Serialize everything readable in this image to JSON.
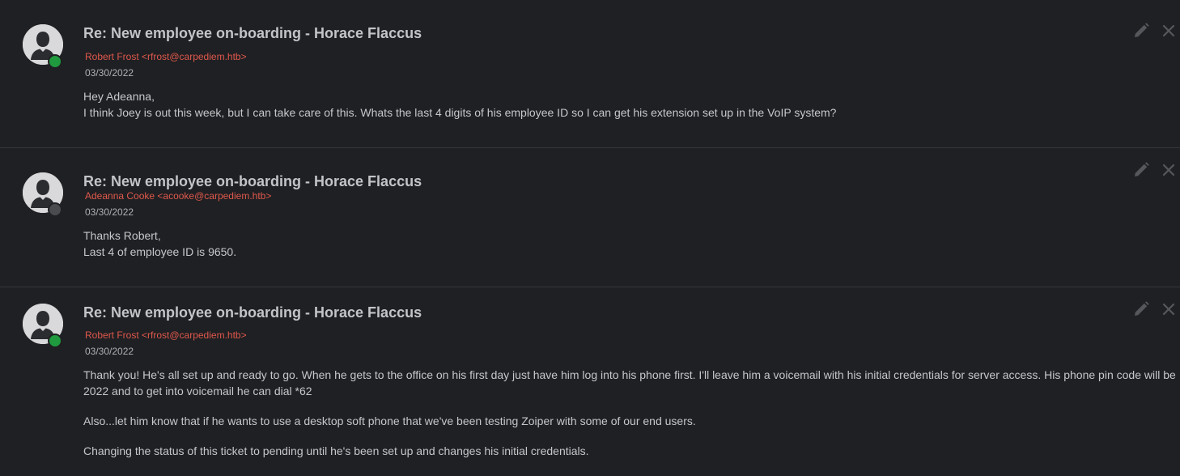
{
  "messages": [
    {
      "subject": "Re: New employee on-boarding - Horace Flaccus",
      "sender": "Robert Frost <rfrost@carpediem.htb>",
      "date": "03/30/2022",
      "status": "online",
      "body": [
        "Hey Adeanna,",
        "I think Joey is out this week, but I can take care of this. Whats the last 4 digits of his employee ID so I can get his extension set up in the VoIP system?"
      ]
    },
    {
      "subject": "Re: New employee on-boarding - Horace Flaccus",
      "sender": "Adeanna Cooke <acooke@carpediem.htb>",
      "date": "03/30/2022",
      "status": "offline",
      "body": [
        "Thanks Robert,",
        "Last 4 of employee ID is 9650."
      ]
    },
    {
      "subject": "Re: New employee on-boarding - Horace Flaccus",
      "sender": "Robert Frost <rfrost@carpediem.htb>",
      "date": "03/30/2022",
      "status": "online",
      "body": [
        "Thank you! He's all set up and ready to go. When he gets to the office on his first day just have him log into his phone first. I'll leave him a voicemail with his initial credentials for server access. His phone pin code will be 2022 and to get into voicemail he can dial *62",
        "Also...let him know that if he wants to use a desktop soft phone that we've been testing Zoiper with some of our end users.",
        "Changing the status of this ticket to pending until he's been set up and changes his initial credentials."
      ]
    }
  ],
  "colors": {
    "background": "#1f2023",
    "sender": "#e0584c",
    "online": "#1f9a3e",
    "offline": "#4a4b4f"
  },
  "icons": {
    "avatar": "user-silhouette-icon",
    "edit": "pencil-icon",
    "delete": "close-icon"
  }
}
